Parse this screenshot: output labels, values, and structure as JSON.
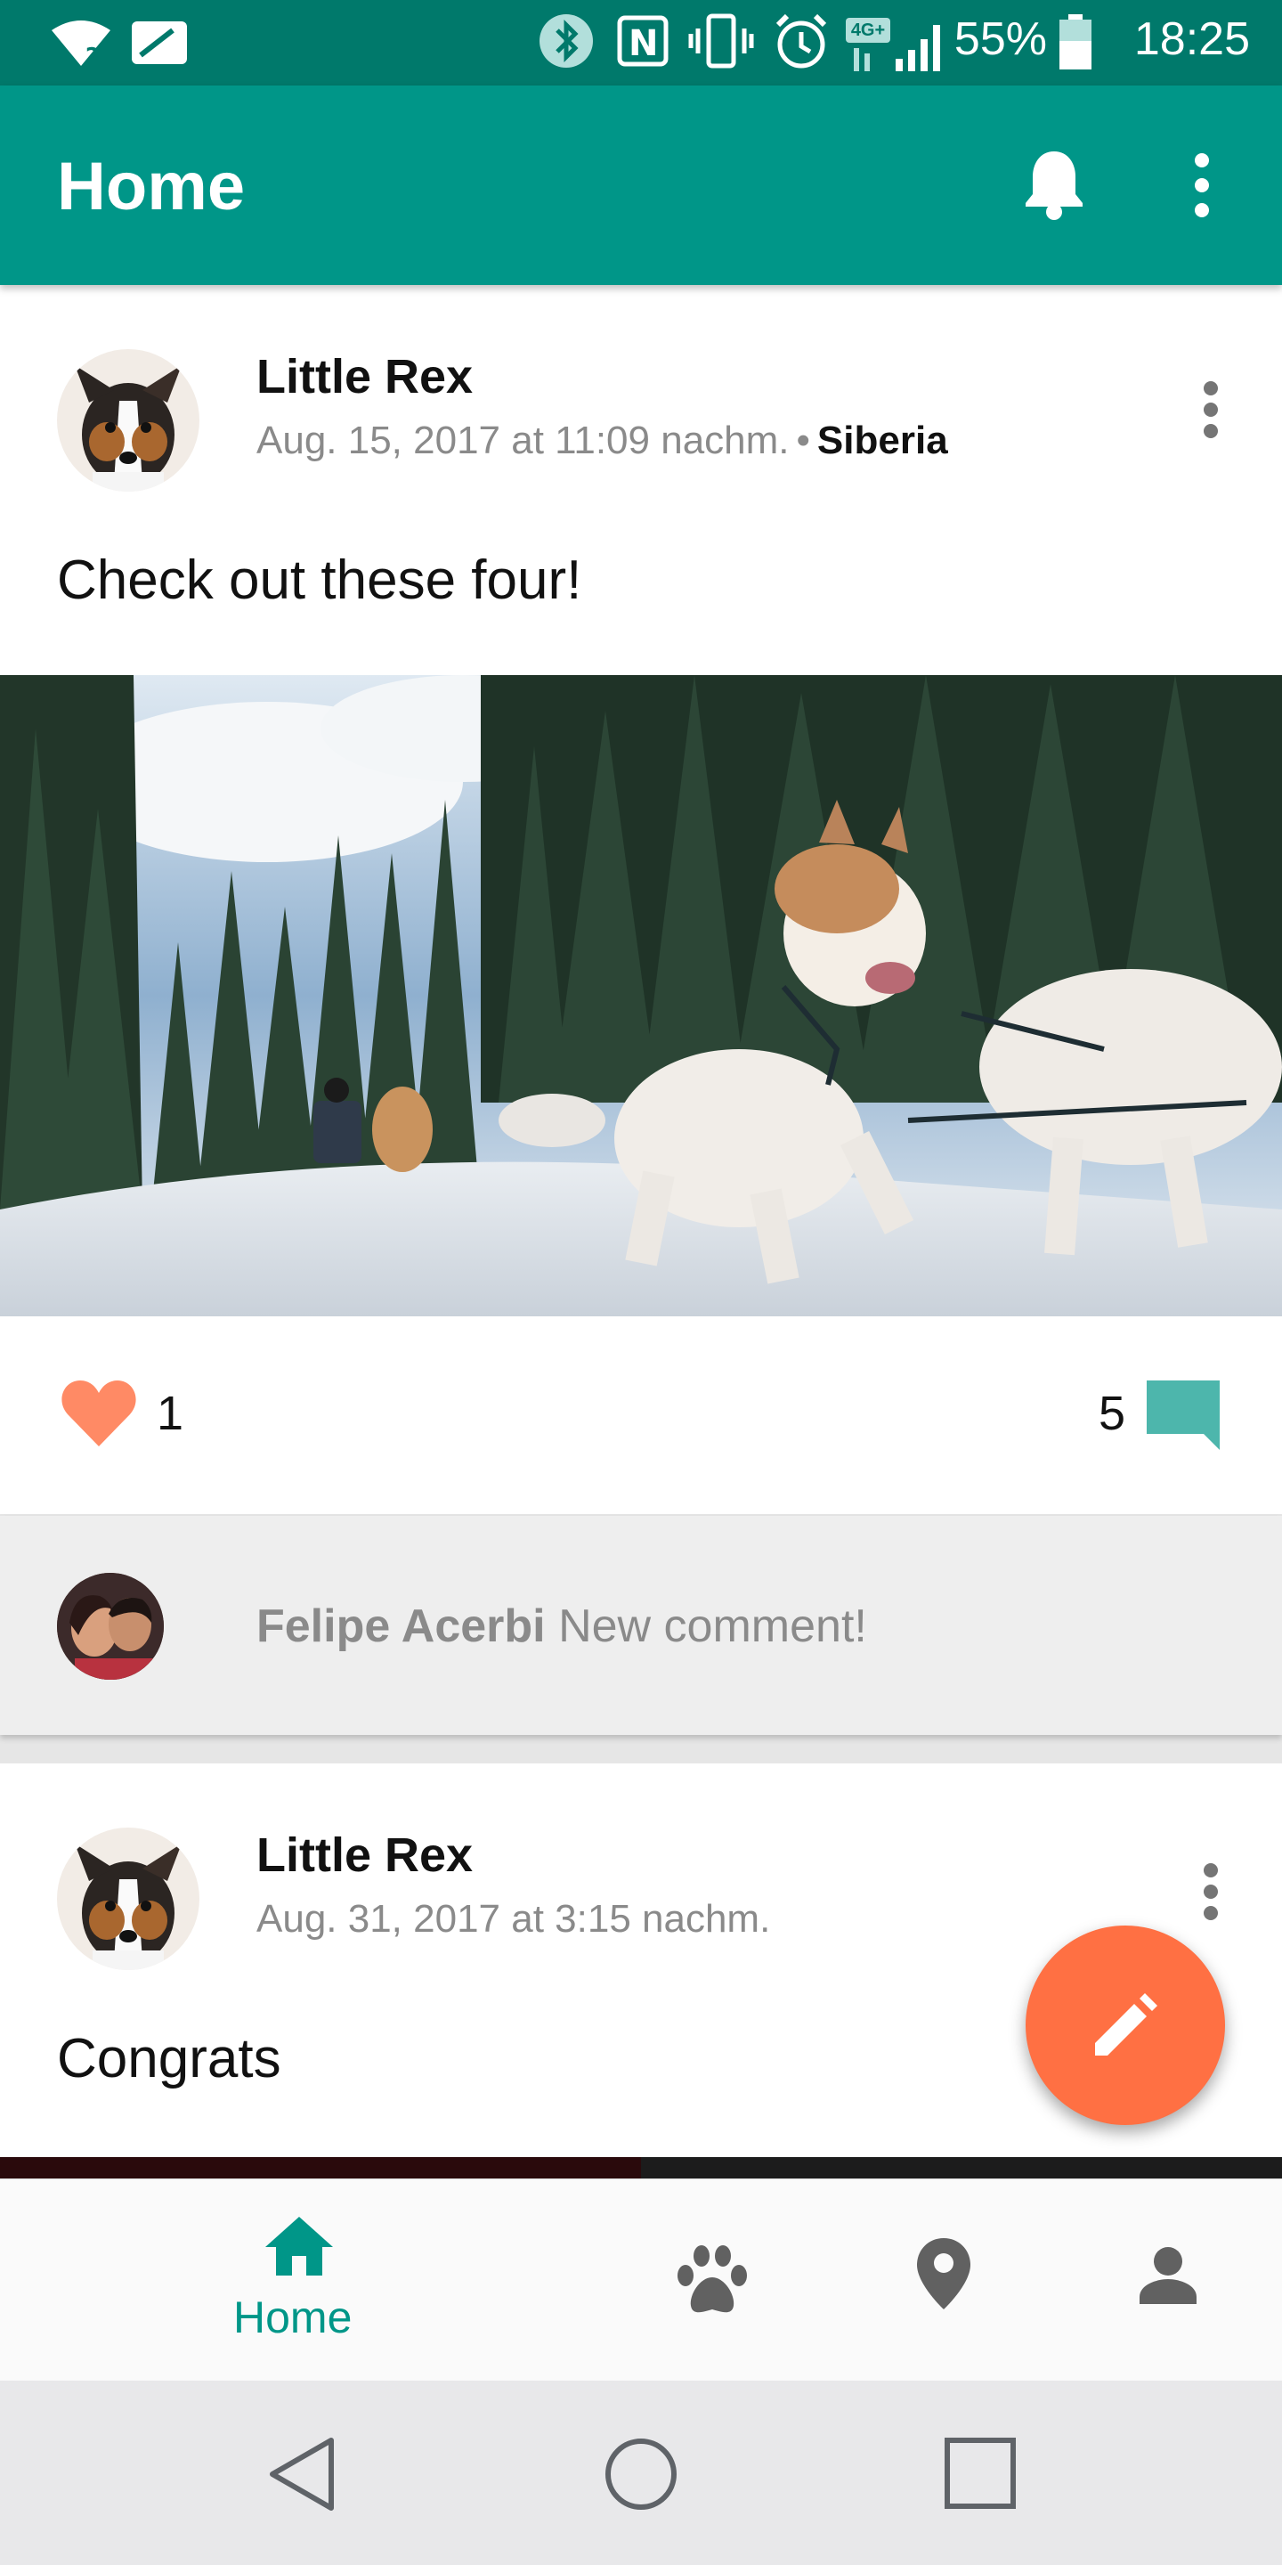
{
  "status_bar": {
    "battery": "55%",
    "time": "18:25",
    "network_badge": "4G+",
    "icons": [
      "wifi-question-icon",
      "no-sim-icon",
      "bluetooth-icon",
      "nfc-icon",
      "vibrate-icon",
      "alarm-icon",
      "signal-icon",
      "battery-icon"
    ]
  },
  "app_bar": {
    "title": "Home",
    "icons": [
      "bell-icon",
      "more-vert-icon"
    ]
  },
  "posts": [
    {
      "author": "Little Rex",
      "timestamp": "Aug. 15, 2017 at 11:09 nachm.",
      "separator": "•",
      "location": "Siberia",
      "text": "Check out these four!",
      "likes": "1",
      "comments": "5",
      "latest_comment": {
        "author": "Felipe Acerbi",
        "text": "New comment!"
      }
    },
    {
      "author": "Little Rex",
      "timestamp": "Aug. 31, 2017 at 3:15 nachm.",
      "text": "Congrats"
    }
  ],
  "bottom_nav": {
    "items": [
      {
        "label": "Home",
        "icon": "home-icon",
        "active": true
      },
      {
        "icon": "paw-icon"
      },
      {
        "icon": "location-pin-icon"
      },
      {
        "icon": "person-icon"
      }
    ]
  },
  "colors": {
    "primary": "#009688",
    "primary_dark": "#00796b",
    "accent": "#ff7043",
    "heart": "#ff8a65",
    "comment_icon": "#4db6ac"
  }
}
